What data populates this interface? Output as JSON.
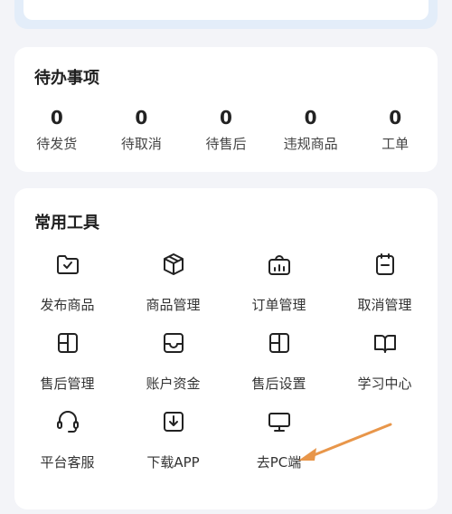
{
  "todo": {
    "title": "待办事项",
    "items": [
      {
        "count": "0",
        "label": "待发货"
      },
      {
        "count": "0",
        "label": "待取消"
      },
      {
        "count": "0",
        "label": "待售后"
      },
      {
        "count": "0",
        "label": "违规商品"
      },
      {
        "count": "0",
        "label": "工单"
      }
    ]
  },
  "tools": {
    "title": "常用工具",
    "items": [
      {
        "label": "发布商品",
        "icon": "folder-check-icon"
      },
      {
        "label": "商品管理",
        "icon": "box-icon"
      },
      {
        "label": "订单管理",
        "icon": "order-chart-icon"
      },
      {
        "label": "取消管理",
        "icon": "clipboard-cancel-icon"
      },
      {
        "label": "售后管理",
        "icon": "grid-panel-icon"
      },
      {
        "label": "账户资金",
        "icon": "tray-icon"
      },
      {
        "label": "售后设置",
        "icon": "grid-panel-icon"
      },
      {
        "label": "学习中心",
        "icon": "book-icon"
      },
      {
        "label": "平台客服",
        "icon": "headset-icon"
      },
      {
        "label": "下载APP",
        "icon": "download-icon"
      },
      {
        "label": "去PC端",
        "icon": "monitor-icon"
      }
    ]
  },
  "colors": {
    "accent_arrow": "#e8964a",
    "card_bg": "#ffffff",
    "page_bg": "#f3f4f8"
  }
}
